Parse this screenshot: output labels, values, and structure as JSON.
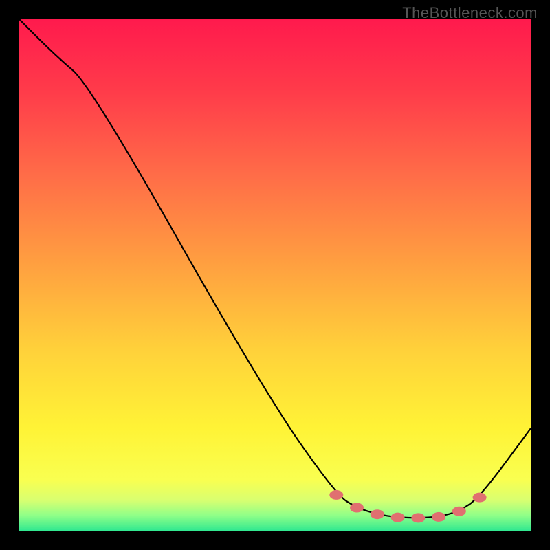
{
  "watermark": "TheBottleneck.com",
  "chart_data": {
    "type": "line",
    "title": "",
    "xlabel": "",
    "ylabel": "",
    "xlim": [
      0,
      100
    ],
    "ylim": [
      0,
      100
    ],
    "series": [
      {
        "name": "curve",
        "x": [
          0,
          7,
          14,
          48,
          62,
          66,
          70,
          74,
          78,
          82,
          86,
          90,
          100
        ],
        "y": [
          100,
          93,
          87,
          27,
          7,
          4.5,
          3.2,
          2.6,
          2.5,
          2.7,
          3.8,
          6.5,
          20
        ]
      }
    ],
    "markers": {
      "x": [
        62,
        66,
        70,
        74,
        78,
        82,
        86,
        90
      ],
      "y": [
        7,
        4.5,
        3.2,
        2.6,
        2.5,
        2.7,
        3.8,
        6.5
      ]
    },
    "gradient_stops": [
      {
        "offset": 0,
        "color": "#ff1a4d"
      },
      {
        "offset": 0.14,
        "color": "#ff3b4a"
      },
      {
        "offset": 0.3,
        "color": "#ff6b48"
      },
      {
        "offset": 0.48,
        "color": "#ffa040"
      },
      {
        "offset": 0.65,
        "color": "#ffd23a"
      },
      {
        "offset": 0.8,
        "color": "#fff336"
      },
      {
        "offset": 0.9,
        "color": "#f9ff50"
      },
      {
        "offset": 0.94,
        "color": "#d9ff70"
      },
      {
        "offset": 0.97,
        "color": "#90ff88"
      },
      {
        "offset": 1.0,
        "color": "#30e890"
      }
    ]
  }
}
